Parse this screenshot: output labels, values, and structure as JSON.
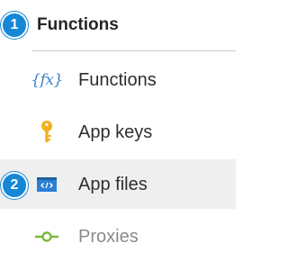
{
  "header": {
    "title": "Functions",
    "badge_number": "1"
  },
  "nav": {
    "items": [
      {
        "label": "Functions",
        "icon": "function-fx-icon",
        "icon_text": "{fx}"
      },
      {
        "label": "App keys",
        "icon": "key-icon"
      },
      {
        "label": "App files",
        "icon": "code-file-icon",
        "selected": true,
        "badge_number": "2"
      },
      {
        "label": "Proxies",
        "icon": "proxy-icon",
        "dimmed": true
      }
    ]
  },
  "colors": {
    "badge": "#1587d6",
    "selected_row": "#efefef",
    "fx_icon": "#3a84c7",
    "key_icon": "#f2b01e",
    "code_icon": "#2a7fd4",
    "proxy_icon": "#7bb73c"
  }
}
